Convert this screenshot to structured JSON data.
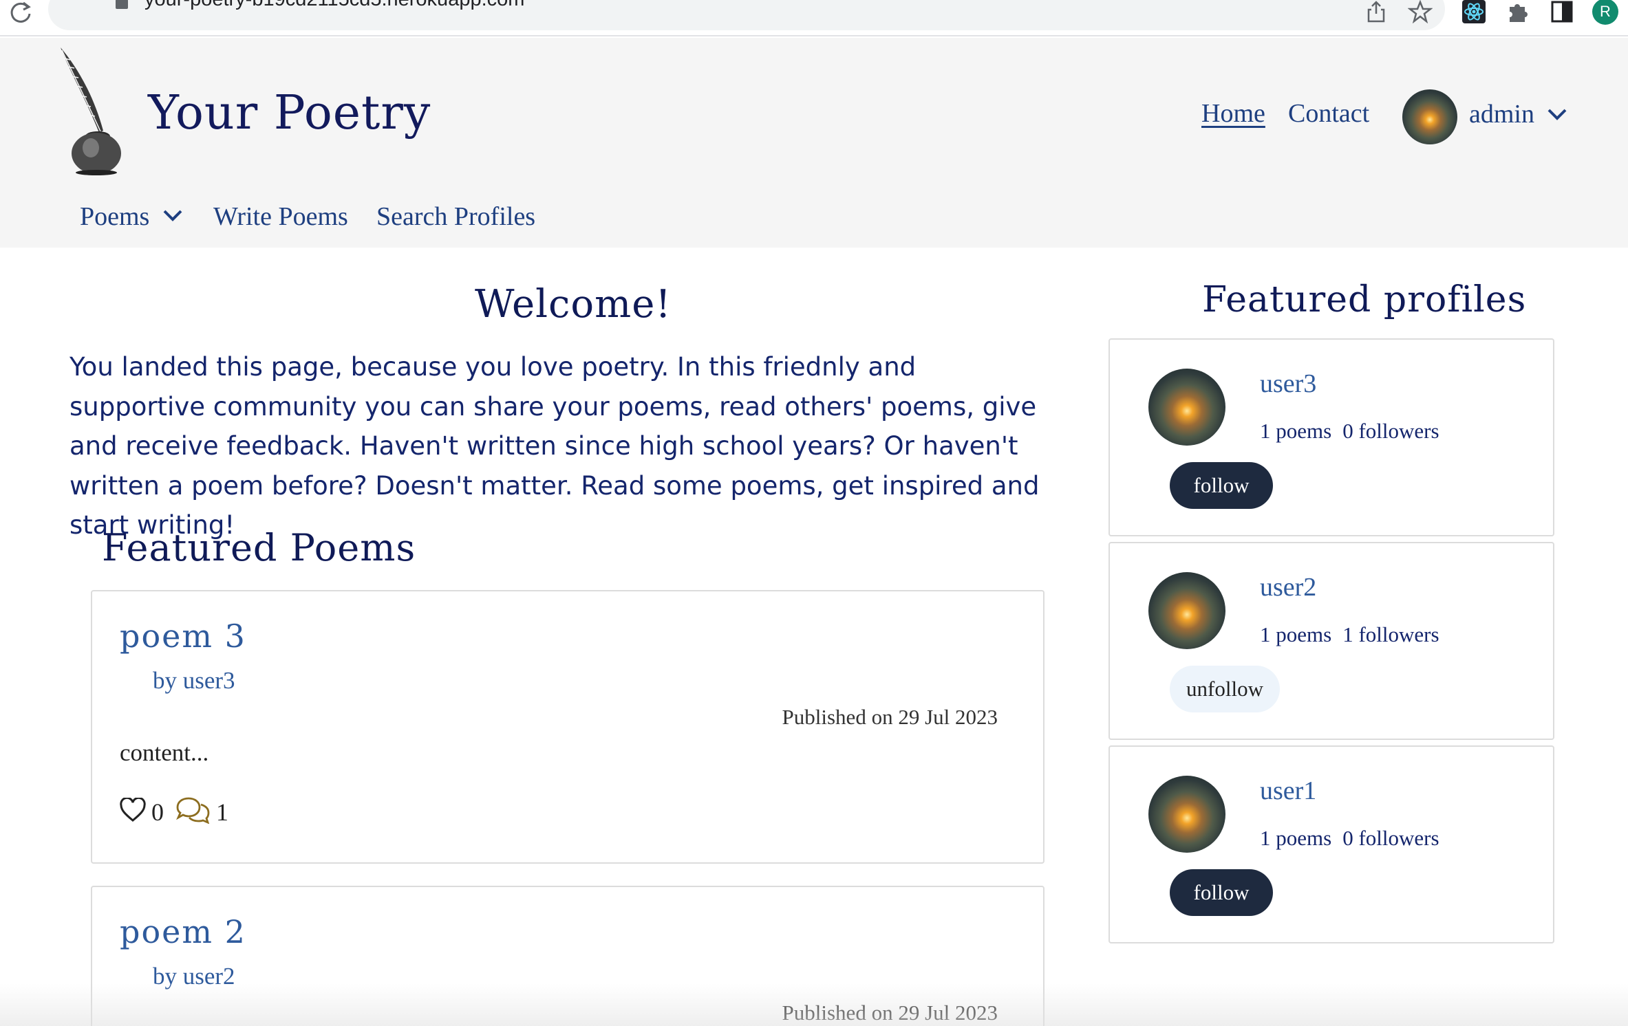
{
  "browser": {
    "url": "your-poetry-b19cd2115cd5.herokuapp.com",
    "profile_initial": "R"
  },
  "header": {
    "brand": "Your Poetry",
    "nav": {
      "home": "Home",
      "contact": "Contact"
    },
    "user": {
      "name": "admin"
    },
    "subnav": {
      "poems": "Poems",
      "write": "Write Poems",
      "search": "Search Profiles"
    }
  },
  "main": {
    "welcome_title": "Welcome!",
    "intro": "You landed this page, because you love poetry. In this friednly and supportive community you can share your poems, read others' poems, give and receive feedback. Haven't written since high school years? Or haven't written a poem before? Doesn't matter. Read some poems, get inspired and start writing!",
    "featured_title": "Featured Poems",
    "poems": [
      {
        "title": "poem 3",
        "author": "by user3",
        "date": "Published on 29 Jul 2023",
        "excerpt": "content...",
        "likes": "0",
        "comments": "1"
      },
      {
        "title": "poem 2",
        "author": "by user2",
        "date": "Published on 29 Jul 2023"
      }
    ]
  },
  "sidebar": {
    "title": "Featured profiles",
    "profiles": [
      {
        "name": "user3",
        "poems": "1 poems",
        "followers": "0 followers",
        "button": "follow"
      },
      {
        "name": "user2",
        "poems": "1 poems",
        "followers": "1 followers",
        "button": "unfollow"
      },
      {
        "name": "user1",
        "poems": "1 poems",
        "followers": "0 followers",
        "button": "follow"
      }
    ]
  },
  "colors": {
    "brand_navy": "#0f1a57",
    "link_blue": "#2e5a9c",
    "follow_button": "#1e2a3f",
    "unfollow_button": "#edf4fb",
    "comment_icon": "#8c6d1f"
  }
}
